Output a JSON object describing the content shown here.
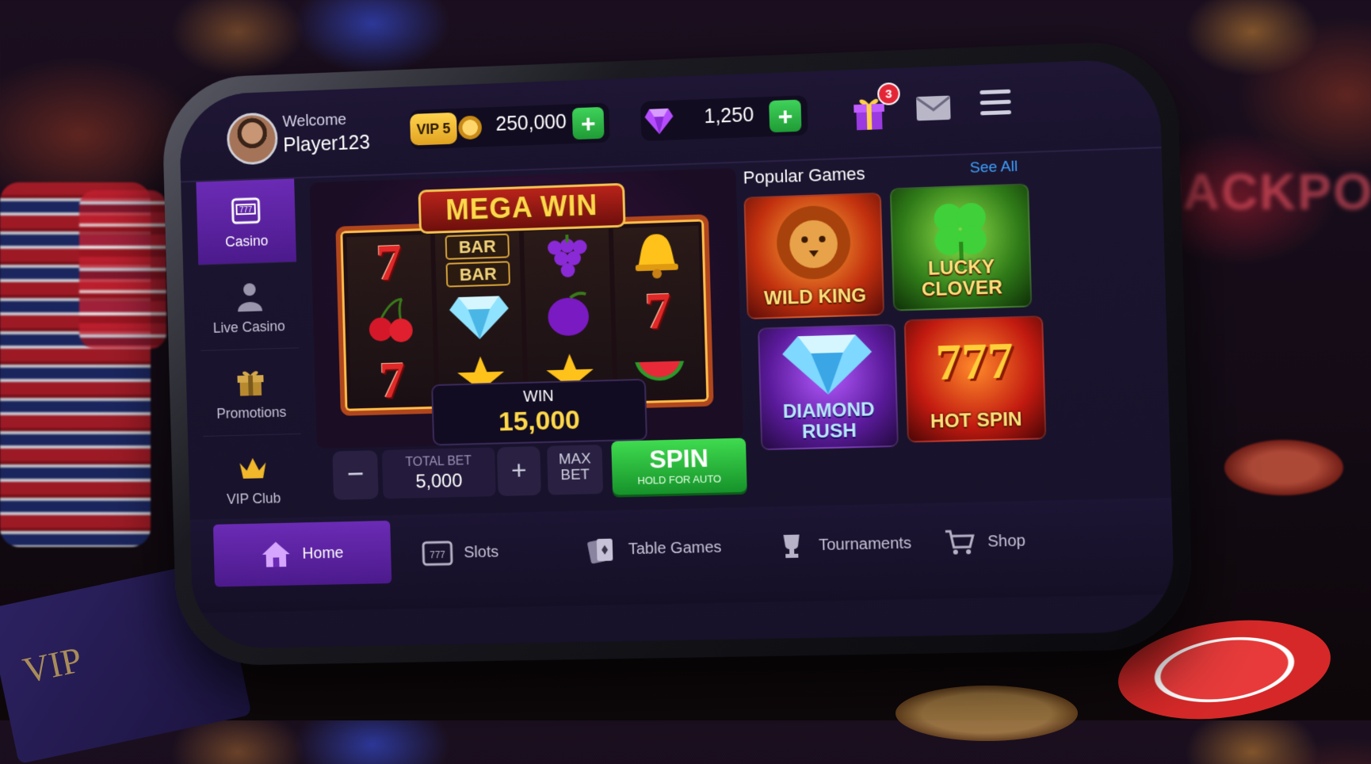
{
  "header": {
    "welcome": "Welcome",
    "username": "Player123",
    "vip_level": "VIP 5",
    "coins": "250,000",
    "gems": "1,250",
    "gift_count": "3",
    "icons": [
      "avatar",
      "coin-icon",
      "add-coins",
      "gem-icon",
      "add-gems",
      "gift-icon",
      "mail-icon",
      "menu-icon"
    ]
  },
  "sidebar": {
    "items": [
      {
        "label": "Casino",
        "icon": "slot-machine-icon",
        "active": true
      },
      {
        "label": "Live Casino",
        "icon": "dealer-icon",
        "active": false
      },
      {
        "label": "Promotions",
        "icon": "gift-icon",
        "active": false
      },
      {
        "label": "VIP Club",
        "icon": "crown-icon",
        "active": false
      }
    ]
  },
  "slot": {
    "banner": "MEGA WIN",
    "reels": [
      [
        "7",
        "cherries",
        "7"
      ],
      [
        "BAR BAR",
        "diamond",
        "star"
      ],
      [
        "grapes",
        "plum",
        "star"
      ],
      [
        "bell",
        "7",
        "watermelon"
      ]
    ],
    "bar_text": "BAR",
    "win_label": "WIN",
    "win_amount": "15,000"
  },
  "bet": {
    "total_bet_label": "TOTAL BET",
    "total_bet": "5,000",
    "plus": "+",
    "max_bet_line1": "MAX",
    "max_bet_line2": "BET",
    "spin_label": "SPIN",
    "spin_sub": "HOLD FOR AUTO"
  },
  "popular": {
    "title": "Popular Games",
    "see_all": "See All",
    "games": [
      {
        "name": "WILD KING",
        "icon": "lion-icon"
      },
      {
        "name": "LUCKY CLOVER",
        "icon": "clover-icon"
      },
      {
        "name": "DIAMOND RUSH",
        "icon": "diamond-icon"
      },
      {
        "name": "777 HOT SPIN",
        "icon": "777-icon"
      }
    ],
    "game4_digits": "777",
    "game4_text": "HOT SPIN",
    "game3_line1": "DIAMOND",
    "game3_line2": "RUSH",
    "game2_line1": "LUCKY CLOVER"
  },
  "bottom_nav": [
    {
      "label": "Home",
      "icon": "home-icon",
      "active": true
    },
    {
      "label": "Slots",
      "icon": "slot-machine-icon",
      "active": false
    },
    {
      "label": "Table Games",
      "icon": "cards-icon",
      "active": false
    },
    {
      "label": "Tournaments",
      "icon": "trophy-icon",
      "active": false
    },
    {
      "label": "Shop",
      "icon": "cart-icon",
      "active": false
    }
  ],
  "background": {
    "sign": "JACKPOT",
    "card": "VIP"
  },
  "colors": {
    "accent_purple": "#6b2bb5",
    "spin_green": "#2fbf44",
    "gold": "#ffd84a",
    "link_blue": "#3da1ff"
  }
}
